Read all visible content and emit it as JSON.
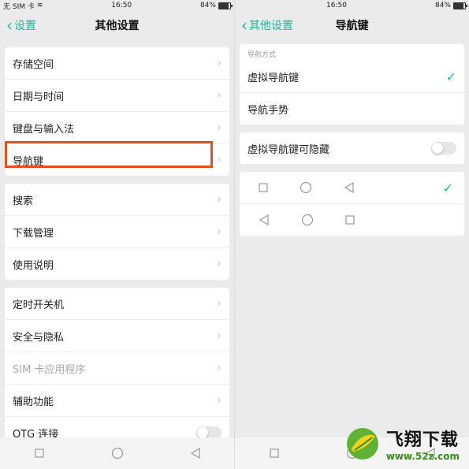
{
  "left": {
    "status": {
      "carrier": "无 SIM 卡",
      "time": "16:50",
      "battery": "84%",
      "battery_level": 0.84
    },
    "nav": {
      "back_label": "设置",
      "title": "其他设置"
    },
    "groups": [
      [
        {
          "label": "存储空间"
        },
        {
          "label": "日期与时间"
        },
        {
          "label": "键盘与输入法"
        },
        {
          "label": "导航键"
        }
      ],
      [
        {
          "label": "搜索"
        },
        {
          "label": "下载管理"
        },
        {
          "label": "使用说明"
        }
      ],
      [
        {
          "label": "定时开关机"
        },
        {
          "label": "安全与隐私"
        },
        {
          "label": "SIM 卡应用程序"
        },
        {
          "label": "辅助功能"
        },
        {
          "label": "OTG 连接"
        }
      ]
    ]
  },
  "right": {
    "status": {
      "time": "16:50",
      "battery": "84%",
      "battery_level": 0.84
    },
    "nav": {
      "back_label": "其他设置",
      "title": "导航键"
    },
    "section_label": "导航方式",
    "options": [
      {
        "label": "虚拟导航键",
        "selected": true
      },
      {
        "label": "导航手势",
        "selected": false
      }
    ],
    "hide_toggle_label": "虚拟导航键可隐藏"
  },
  "watermark": {
    "title": "飞翔下载",
    "url": "www.52z.com"
  },
  "colors": {
    "accent": "#1fb59c",
    "highlight": "#e2501d"
  }
}
